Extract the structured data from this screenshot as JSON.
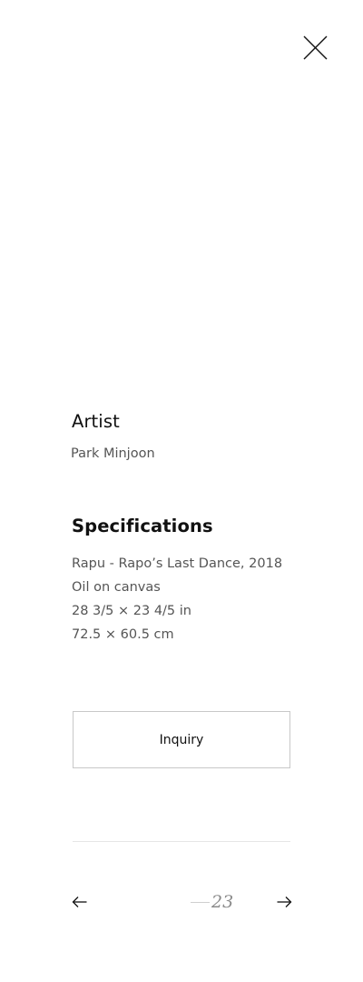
{
  "artist": {
    "heading": "Artist",
    "name": "Park Minjoon"
  },
  "specifications": {
    "heading": "Specifications",
    "lines": [
      "Rapu - Rapo’s Last Dance, 2018",
      "Oil on canvas",
      "28 3/5 × 23 4/5 in",
      "72.5 × 60.5 cm"
    ]
  },
  "inquiry": {
    "label": "Inquiry"
  },
  "pagination": {
    "current": "23"
  },
  "icons": {
    "close": "close-icon",
    "prev": "arrow-left-icon",
    "next": "arrow-right-icon"
  }
}
